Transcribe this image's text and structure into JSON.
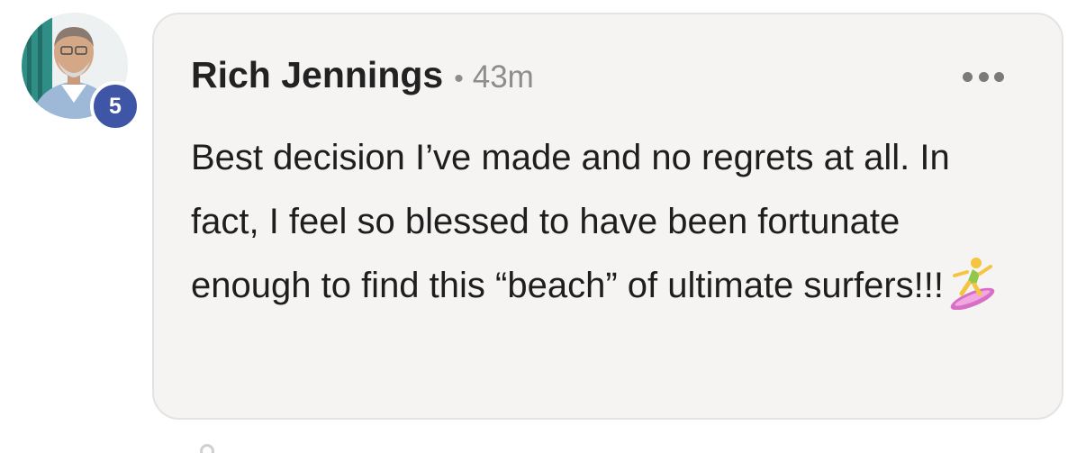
{
  "comment": {
    "author": "Rich Jennings",
    "separator": "•",
    "timestamp": "43m",
    "level_badge": "5",
    "body_text": "Best decision I’ve made and no regrets at all. In fact, I feel so blessed to have been fortunate enough to find this “beach” of ultimate surfers!!!",
    "emoji": "surfer-emoji"
  },
  "icons": {
    "more_options": "more-options-icon",
    "avatar": "avatar-photo"
  },
  "colors": {
    "badge": "#3f55a6",
    "bubble_bg": "#f5f4f3",
    "bubble_border": "#e3e3e3",
    "author_text": "#222222",
    "meta_text": "#8d8d8d"
  }
}
